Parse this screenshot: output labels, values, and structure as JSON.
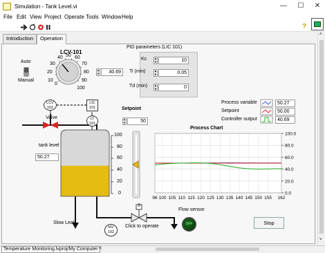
{
  "window": {
    "title": "Simulation - Tank Level.vi",
    "controls": [
      "—",
      "☐",
      "✕"
    ]
  },
  "menu": [
    "File",
    "Edit",
    "View",
    "Project",
    "Operate",
    "Tools",
    "Window",
    "Help"
  ],
  "tabs": [
    "Introduction",
    "Operation"
  ],
  "active_tab": "Operation",
  "lcv": {
    "title": "LCV-101",
    "value": "40.69",
    "ticks": [
      "0",
      "10",
      "20",
      "30",
      "40",
      "50",
      "60",
      "70",
      "80",
      "90",
      "100"
    ],
    "mode_auto": "Auto",
    "mode_manual": "Manual"
  },
  "pid": {
    "title": "PID parameters (LIC 101)",
    "kc_label": "Kc",
    "kc_value": "10",
    "ti_label": "Ti (min)",
    "ti_value": "0.05",
    "td_label": "Td (min)",
    "td_value": "0"
  },
  "diagram": {
    "lcv_tag": "LCV",
    "lcv_num": "101",
    "lic_tag": "LIC",
    "lic_num": "101",
    "lt_tag": "LT",
    "lt_num": "101",
    "valve_label": "Valve",
    "tank_level_label": "tank level",
    "tank_level_value": "50.27",
    "tank_level_fraction": 0.5027,
    "slow_leak_label": "Slow Leak",
    "hv_tag": "HV",
    "hv_num": "102",
    "s_tag": "S",
    "click_label": "Click to operate",
    "flow_sensor_label": "Flow sensor",
    "flow_led_text": "OFF"
  },
  "tank_scale": [
    "100",
    "80",
    "60",
    "40",
    "20",
    "0"
  ],
  "setpoint": {
    "label": "Setpoint",
    "value": "50",
    "level_fraction": 0.5
  },
  "chart": {
    "title": "Process Chart",
    "legend": [
      {
        "name": "Process variable",
        "value": "50.27",
        "color": "#3355cc"
      },
      {
        "name": "Setpoint",
        "value": "50.00",
        "color": "#dd2222"
      },
      {
        "name": "Controller output",
        "value": "40.69",
        "color": "#22aa22"
      }
    ]
  },
  "chart_data": {
    "type": "line",
    "title": "Process Chart",
    "x": [
      96,
      100,
      105,
      110,
      115,
      120,
      125,
      130,
      135,
      140,
      145,
      150,
      155,
      162
    ],
    "xticks": [
      "96",
      "100",
      "105",
      "110",
      "115",
      "120",
      "125",
      "130",
      "135",
      "140",
      "145",
      "150",
      "155",
      "162"
    ],
    "yticks": [
      "100.0",
      "80.0",
      "60.0",
      "40.0",
      "20.0",
      "0.0"
    ],
    "xlim": [
      96,
      162
    ],
    "ylim": [
      0,
      100
    ],
    "series": [
      {
        "name": "Process variable",
        "color": "#3355cc",
        "values": [
          50.2,
          50.2,
          50.1,
          50.0,
          50.0,
          50.1,
          50.3,
          50.5,
          50.6,
          50.5,
          50.4,
          50.3,
          50.3,
          50.27
        ]
      },
      {
        "name": "Setpoint",
        "color": "#dd2222",
        "values": [
          50,
          50,
          50,
          50,
          50,
          50,
          50,
          50,
          50,
          50,
          50,
          50,
          50,
          50
        ]
      },
      {
        "name": "Controller output",
        "color": "#22aa22",
        "values": [
          47.0,
          48.5,
          49.5,
          50.0,
          50.5,
          50.5,
          49.5,
          47.5,
          44.5,
          42.0,
          40.5,
          40.0,
          40.2,
          40.69
        ]
      }
    ]
  },
  "stop_label": "Stop",
  "status": {
    "path": "Temperature Monitoring.lvproj/My Computer",
    "arrow": "<"
  },
  "colors": {
    "tank_fluid": "#e6bb12",
    "tank_empty": "#d8d8d8",
    "pipe": "#111111",
    "valve_red": "#dd2222",
    "accent": "#1b6ac9"
  }
}
